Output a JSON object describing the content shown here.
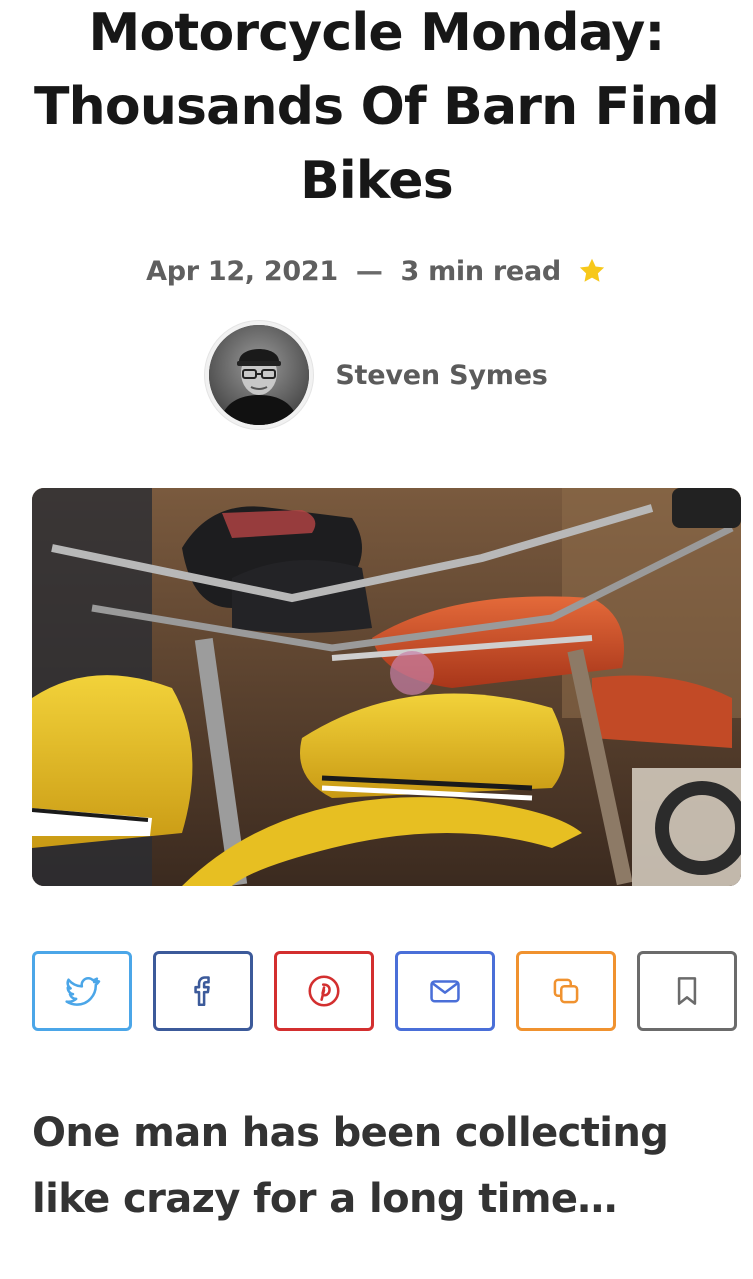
{
  "article": {
    "title": "Motorcycle Monday: Thousands Of Barn Find Bikes",
    "date": "Apr 12, 2021",
    "separator": "—",
    "read_time": "3 min read",
    "featured_icon": "star-icon",
    "author": {
      "name": "Steven Symes"
    },
    "lead": "One man has been collecting like crazy for a long time…"
  },
  "share": {
    "buttons": [
      {
        "id": "twitter",
        "icon": "twitter-icon",
        "color": "#4ba6e8"
      },
      {
        "id": "facebook",
        "icon": "facebook-icon",
        "color": "#3c5a9a"
      },
      {
        "id": "pinterest",
        "icon": "pinterest-icon",
        "color": "#d32f2f"
      },
      {
        "id": "email",
        "icon": "mail-icon",
        "color": "#4a6fd8"
      },
      {
        "id": "copy-link",
        "icon": "copy-icon",
        "color": "#f0922f"
      },
      {
        "id": "bookmark",
        "icon": "bookmark-icon",
        "color": "#6b6b6b"
      }
    ]
  },
  "colors": {
    "title": "#171717",
    "meta": "#5f5f5f",
    "star": "#f7c81b",
    "lead": "#333333"
  }
}
